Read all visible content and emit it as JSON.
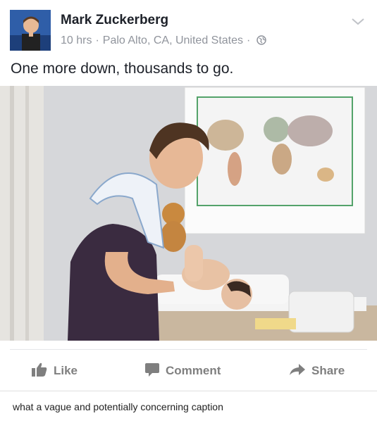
{
  "post": {
    "author": "Mark Zuckerberg",
    "time": "10 hrs",
    "location": "Palo Alto, CA, United States",
    "privacy_icon": "globe-icon",
    "text": "One more down, thousands to go.",
    "photo_icon": "photo-image"
  },
  "actions": {
    "like": "Like",
    "comment": "Comment",
    "share": "Share"
  },
  "caption": "what a vague and potentially concerning caption",
  "colors": {
    "text": "#1d2129",
    "meta": "#90949c",
    "action": "#7f7f7f",
    "avatar_bg": "#2f5ea8"
  }
}
